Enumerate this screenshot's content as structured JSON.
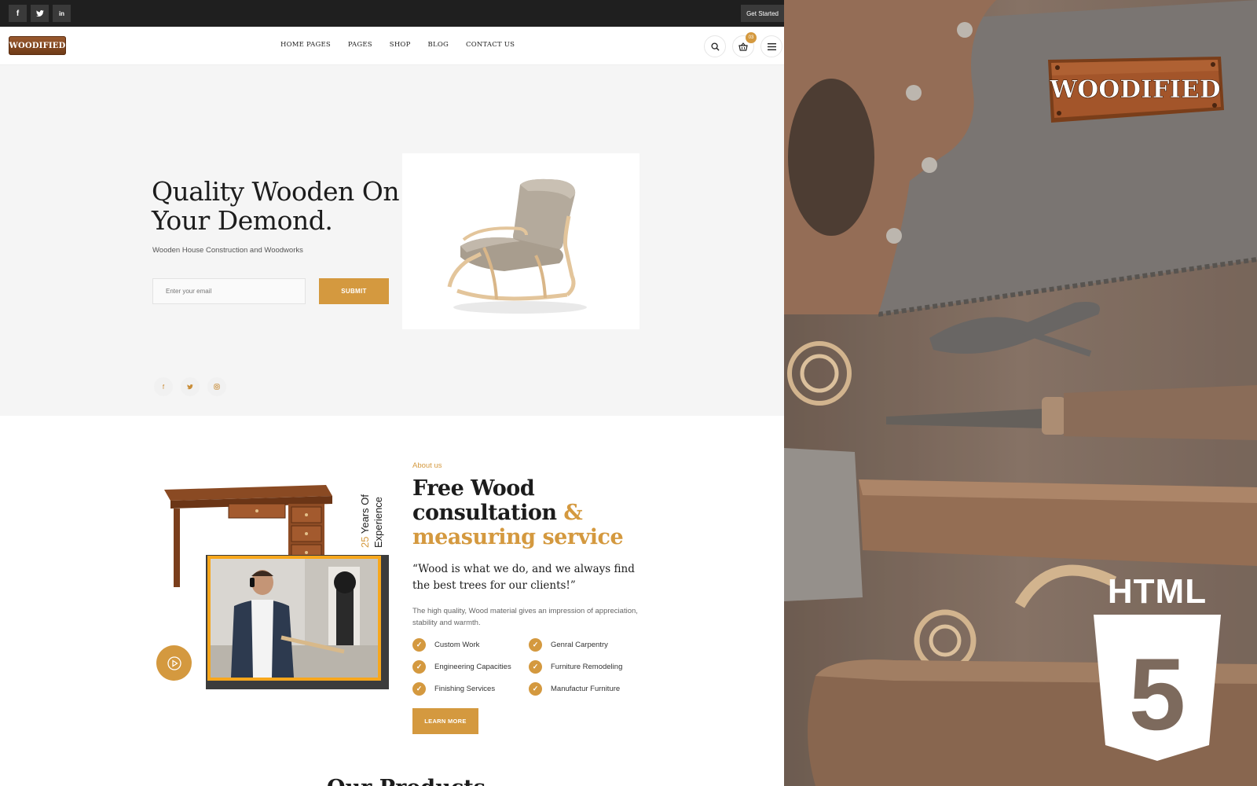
{
  "topbar": {
    "social": [
      "f",
      "t",
      "in"
    ],
    "cta": "Get Started"
  },
  "header": {
    "logo_text": "WOODIFIED",
    "nav": [
      "HOME PAGES",
      "PAGES",
      "SHOP",
      "BLOG",
      "CONTACT US"
    ],
    "cart_count": "03",
    "icons": [
      "search-icon",
      "basket-icon",
      "menu-icon"
    ]
  },
  "hero": {
    "title_line1": "Quality Wooden On",
    "title_line2": "Your Demond.",
    "subtitle": "Wooden House Construction and Woodworks",
    "email_placeholder": "Enter your email",
    "submit_label": "SUBMIT",
    "social": [
      "f",
      "t",
      "ig"
    ]
  },
  "about": {
    "experience_number": "25",
    "experience_line1": "Years Of",
    "experience_line2": "Experience",
    "label": "About us",
    "title_line1": "Free Wood",
    "title_line2": "consultation",
    "title_amp": "&",
    "title_line3": "measuring service",
    "quote": "“Wood is what we do, and we always find the best trees for our clients!”",
    "paragraph": "The high quality, Wood material gives an impression of appreciation, stability and warmth.",
    "features": [
      "Custom Work",
      "Genral Carpentry",
      "Engineering Capacities",
      "Furniture Remodeling",
      "Finishing Services",
      "Manufactur Furniture"
    ],
    "learn_more_label": "LEARN MORE"
  },
  "products": {
    "heading": "Our Products"
  },
  "promo": {
    "logo_text": "WOODIFIED",
    "badge_text": "HTML",
    "badge_number": "5"
  },
  "colors": {
    "accent": "#d4993f",
    "topbar": "#1f1f1f",
    "hero_bg": "#f5f5f5",
    "photo_frame": "#f7a71c"
  }
}
